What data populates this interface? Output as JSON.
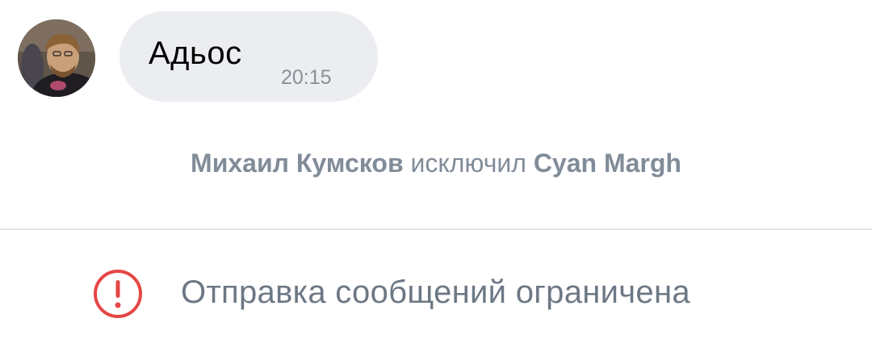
{
  "message": {
    "text": "Адьос",
    "time": "20:15"
  },
  "service_message": {
    "actor": "Михаил Кумсков",
    "action": "исключил",
    "target": "Cyan Margh"
  },
  "restriction": {
    "icon": "alert-circle-icon",
    "text": "Отправка сообщений ограничена"
  },
  "colors": {
    "bubble": "#ebedf0",
    "service_text": "#818c99",
    "restriction_text": "#6d7885",
    "alert": "#e64646"
  }
}
